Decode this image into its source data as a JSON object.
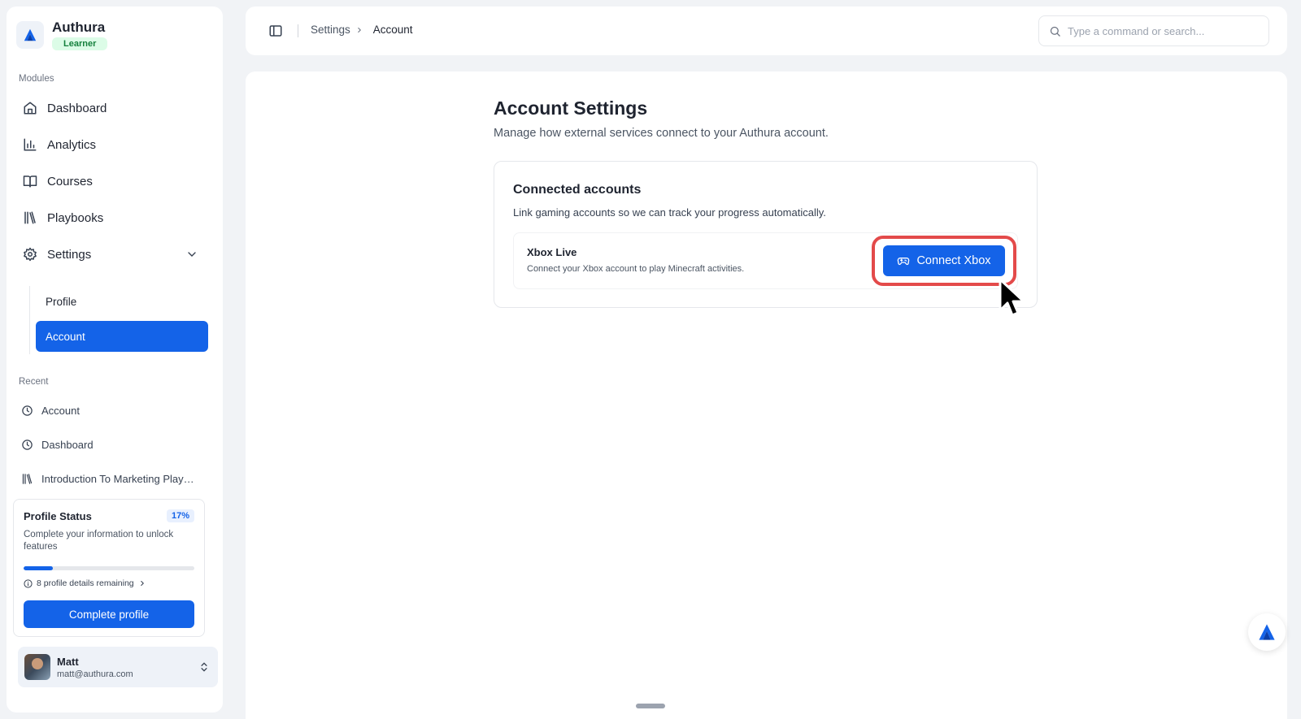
{
  "app": {
    "name": "Authura",
    "role_badge": "Learner"
  },
  "sidebar": {
    "modules_label": "Modules",
    "items": [
      {
        "label": "Dashboard",
        "icon": "home-icon"
      },
      {
        "label": "Analytics",
        "icon": "bar-chart-icon"
      },
      {
        "label": "Courses",
        "icon": "book-icon"
      },
      {
        "label": "Playbooks",
        "icon": "library-icon"
      },
      {
        "label": "Settings",
        "icon": "gear-icon",
        "expanded": true
      }
    ],
    "settings_sub": [
      {
        "label": "Profile",
        "active": false
      },
      {
        "label": "Account",
        "active": true
      }
    ],
    "recent_label": "Recent",
    "recent": [
      {
        "label": "Account",
        "icon": "clock-icon"
      },
      {
        "label": "Dashboard",
        "icon": "clock-icon"
      },
      {
        "label": "Introduction To Marketing Playbooks",
        "icon": "library-icon"
      }
    ]
  },
  "profile_status": {
    "title": "Profile Status",
    "percent_label": "17%",
    "progress": 0.17,
    "description": "Complete your information to unlock features",
    "remaining": "8 profile details remaining",
    "button": "Complete profile"
  },
  "user": {
    "name": "Matt",
    "email": "matt@authura.com"
  },
  "header": {
    "breadcrumb_parent": "Settings",
    "breadcrumb_current": "Account",
    "search_placeholder": "Type a command or search..."
  },
  "page": {
    "title": "Account Settings",
    "subtitle": "Manage how external services connect to your Authura account."
  },
  "connected_accounts": {
    "title": "Connected accounts",
    "description": "Link gaming accounts so we can track your progress automatically.",
    "service": {
      "name": "Xbox Live",
      "description": "Connect your Xbox account to play Minecraft activities.",
      "button": "Connect Xbox",
      "button_icon": "gamepad-icon"
    }
  },
  "colors": {
    "accent": "#1463e8",
    "highlight": "#e34a4a",
    "badge_green": "#15803d"
  }
}
